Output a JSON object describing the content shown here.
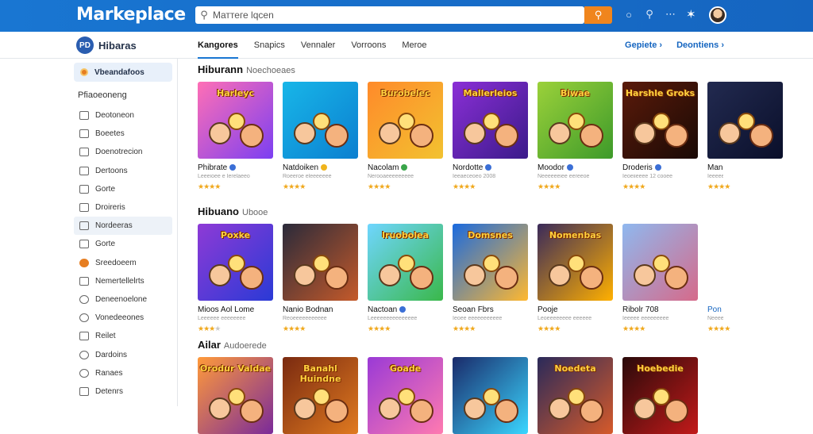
{
  "header": {
    "logo": "Markeplace",
    "search_placeholder": "Mаттеге lqcen",
    "icons": [
      "chat-icon",
      "search-icon",
      "more-icon",
      "star-badge-icon",
      "user-avatar"
    ]
  },
  "subheader": {
    "brand_badge": "PD",
    "brand_name": "Hibaras",
    "tabs": [
      "Kangores",
      "Snapics",
      "Vennaler",
      "Vorroons",
      "Meroe"
    ],
    "active_tab": 0,
    "links": [
      "Gepiete ›",
      "Deontiens ›"
    ]
  },
  "sidebar": {
    "top_item": "Vbeandafoos",
    "heading": "Pfiaoeoneng",
    "items": [
      {
        "label": "Deotoneon",
        "icon": "doc-icon"
      },
      {
        "label": "Boeetes",
        "icon": "doc-icon"
      },
      {
        "label": "Doenotrecion",
        "icon": "doc-icon"
      },
      {
        "label": "Dertoons",
        "icon": "doc-icon"
      },
      {
        "label": "Gorte",
        "icon": "lock-icon"
      },
      {
        "label": "Droireris",
        "icon": "doc-icon"
      },
      {
        "label": "Nordeeras",
        "icon": "doc-icon",
        "highlight": true
      },
      {
        "label": "Gorte",
        "icon": "doc-icon"
      },
      {
        "label": "Sreedoeem",
        "icon": "coin-icon"
      },
      {
        "label": "Nemertellelrts",
        "icon": "doc-icon"
      },
      {
        "label": "Deneenoelone",
        "icon": "circle-icon"
      },
      {
        "label": "Vonedeeones",
        "icon": "circle-icon"
      },
      {
        "label": "Reilet",
        "icon": "doc-icon"
      },
      {
        "label": "Dardoins",
        "icon": "circle-icon"
      },
      {
        "label": "Ranaes",
        "icon": "circle-icon"
      },
      {
        "label": "Detenrs",
        "icon": "doc-icon"
      }
    ]
  },
  "sections": [
    {
      "title": "Hiburann",
      "subtitle": "Noechoeaes",
      "cards": [
        {
          "name": "Phibrate",
          "meta": "Leeeioee e Ierelaeeo",
          "stars": 4,
          "art": "Harleyc"
        },
        {
          "name": "Natdoiken",
          "meta": "Roeeroe eleeeeeee",
          "stars": 4,
          "art": ""
        },
        {
          "name": "Nacolam",
          "meta": "Nerooaeeeeeeeee",
          "stars": 4,
          "art": "Burobelec"
        },
        {
          "name": "Nordotte",
          "meta": "Ieeaeceoeo 2008",
          "stars": 4,
          "art": "Mallerleios"
        },
        {
          "name": "Moodor",
          "meta": "Neeeeeeiee eereeoe",
          "stars": 4,
          "art": "Biwae"
        },
        {
          "name": "Droderis",
          "meta": "Ieoeiieeee 12 cooee",
          "stars": 4,
          "art": "Harshle Groks"
        },
        {
          "name": "Man",
          "meta": "Ieeeee",
          "stars": 4,
          "art": ""
        }
      ]
    },
    {
      "title": "Hibuano",
      "subtitle": "Ubooe",
      "cards": [
        {
          "name": "Mioos Aol Lome",
          "meta": "Leeeeee eeeeeeee",
          "stars": 3,
          "art": "Poxke"
        },
        {
          "name": "Nanio Bodnan",
          "meta": "Reoeeeeeeeeeee",
          "stars": 4,
          "art": ""
        },
        {
          "name": "Nactoan",
          "meta": "Leeeeeeeeeeeeeee",
          "stars": 4,
          "art": "Iruobolea"
        },
        {
          "name": "Seoan Fbrs",
          "meta": "Ieoee eeeeeeeeeee",
          "stars": 4,
          "art": "Domsnes"
        },
        {
          "name": "Pooje",
          "meta": "Leoeeeeeeee eeeeee",
          "stars": 4,
          "art": "Nomenbas"
        },
        {
          "name": "Ribolr 708",
          "meta": "Ieeeee eeeeeeeee",
          "stars": 4,
          "art": ""
        },
        {
          "name": "Pon",
          "meta": "Neeee",
          "stars": 4,
          "art": ""
        }
      ]
    },
    {
      "title": "Ailar",
      "subtitle": "Audoerede",
      "cards": [
        {
          "name": "",
          "meta": "",
          "stars": 0,
          "art": "Orodur Valdae"
        },
        {
          "name": "",
          "meta": "",
          "stars": 0,
          "art": "Banahl Huindne"
        },
        {
          "name": "",
          "meta": "",
          "stars": 0,
          "art": "Goade"
        },
        {
          "name": "",
          "meta": "",
          "stars": 0,
          "art": ""
        },
        {
          "name": "",
          "meta": "",
          "stars": 0,
          "art": "Noedeta"
        },
        {
          "name": "",
          "meta": "",
          "stars": 0,
          "art": "Hoebedie"
        }
      ]
    }
  ],
  "colors": {
    "header_bg": "#1976d2",
    "search_button": "#f0851d",
    "accent": "#1565c0",
    "star": "#f0a81c"
  }
}
